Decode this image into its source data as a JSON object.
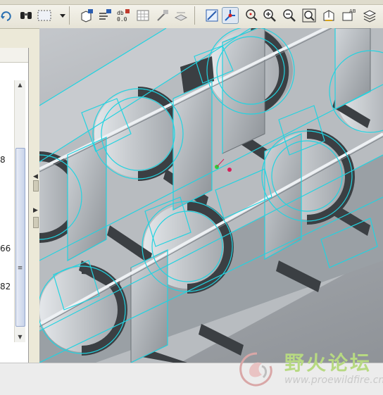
{
  "toolbar": {
    "buttons": [
      {
        "name": "binoculars-find-button",
        "icon": "binoculars-icon"
      },
      {
        "name": "select-box-button",
        "icon": "dashed-box-icon"
      },
      {
        "name": "select-dropdown-button",
        "icon": "chevron-down-icon"
      },
      {
        "name": "model-analysis-button",
        "icon": "box-analysis-icon"
      },
      {
        "name": "measure-info-button",
        "icon": "text-lines-icon"
      },
      {
        "name": "parameter-info-button",
        "icon": "parameter-icon"
      },
      {
        "name": "relations-button",
        "icon": "grid-relations-icon"
      },
      {
        "name": "feature-build-button",
        "icon": "wand-icon"
      },
      {
        "name": "layer-button",
        "icon": "layer-icon"
      },
      {
        "name": "repaint-button",
        "icon": "repaint-icon"
      },
      {
        "name": "spin-center-button",
        "icon": "spin-center-icon"
      },
      {
        "name": "orient-mode-button",
        "icon": "orient-icon"
      },
      {
        "name": "zoom-in-button",
        "icon": "zoom-in-icon"
      },
      {
        "name": "zoom-out-button",
        "icon": "zoom-out-icon"
      },
      {
        "name": "refit-button",
        "icon": "refit-icon"
      },
      {
        "name": "saved-views-button",
        "icon": "saved-views-icon"
      },
      {
        "name": "view-manager-button",
        "icon": "view-manager-icon"
      },
      {
        "name": "layers-button",
        "icon": "layers-stack-icon"
      }
    ]
  },
  "left_panel": {
    "values": [
      "8",
      "66",
      "82"
    ]
  },
  "viewport": {
    "edge_color": "#22d3e0",
    "surface_color": "#b6babe",
    "dark_color": "#3b3f43"
  },
  "watermark": {
    "brand": "野火论坛",
    "url": "www.proewildfire.cn"
  }
}
